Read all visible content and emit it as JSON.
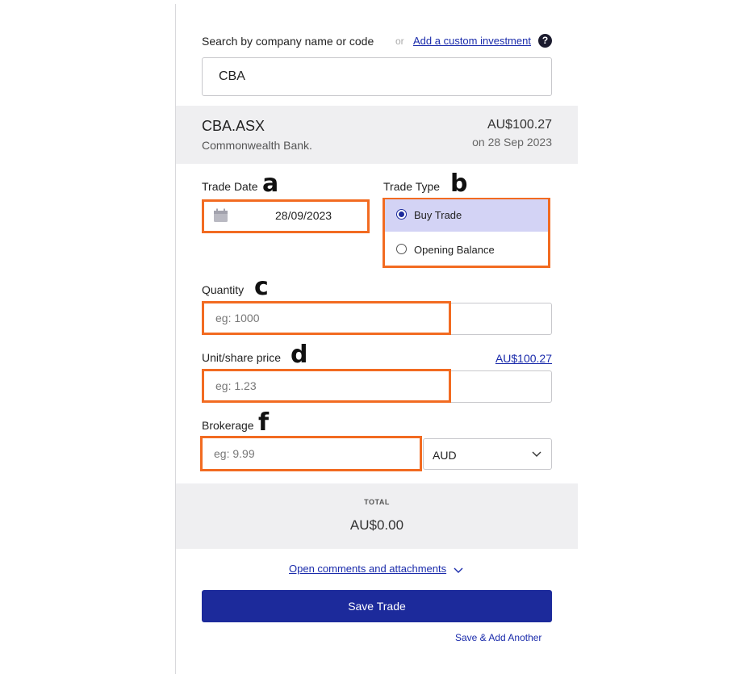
{
  "search": {
    "label": "Search by company name or code",
    "or_text": "or",
    "custom_link": "Add a custom investment",
    "help_icon": "?",
    "value": "CBA"
  },
  "company": {
    "ticker": "CBA.ASX",
    "name": "Commonwealth Bank.",
    "price": "AU$100.27",
    "price_date": "on 28 Sep 2023"
  },
  "trade_date": {
    "label": "Trade Date",
    "value": "28/09/2023",
    "icon": "calendar-icon"
  },
  "trade_type": {
    "label": "Trade Type",
    "options": [
      {
        "label": "Buy Trade",
        "selected": true
      },
      {
        "label": "Opening Balance",
        "selected": false
      }
    ]
  },
  "quantity": {
    "label": "Quantity",
    "placeholder": "eg: 1000"
  },
  "unit_price": {
    "label": "Unit/share price",
    "placeholder": "eg: 1.23",
    "current_price_link": "AU$100.27"
  },
  "brokerage": {
    "label": "Brokerage",
    "placeholder": "eg: 9.99",
    "currency": "AUD"
  },
  "total": {
    "label": "TOTAL",
    "value": "AU$0.00"
  },
  "comments_link": "Open comments and attachments",
  "save_button": "Save Trade",
  "save_add_link": "Save & Add Another",
  "annotations": {
    "a": "a",
    "b": "b",
    "c": "c",
    "d": "d",
    "f": "f"
  },
  "colors": {
    "primary": "#1c2a9b",
    "highlight": "#f26b21",
    "selected_option": "#d3d3f5",
    "panel_bg": "#efeff1"
  }
}
